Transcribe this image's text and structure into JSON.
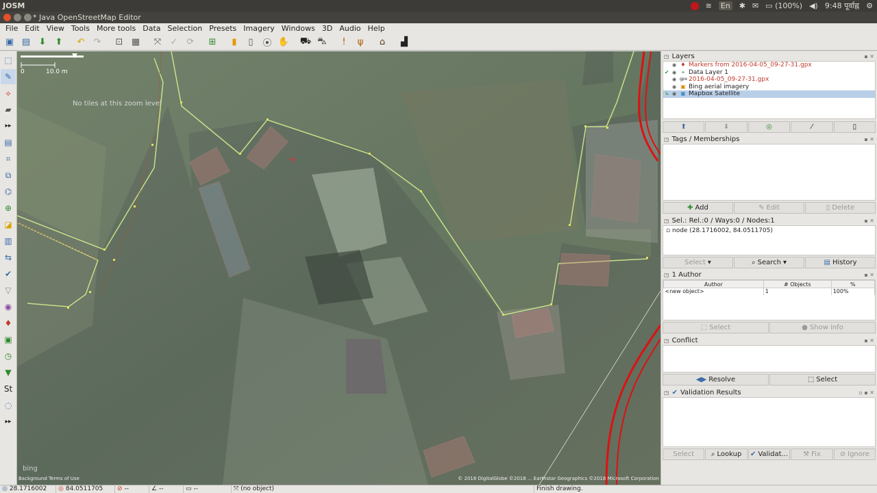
{
  "os": {
    "app_name": "JOSM",
    "language": "En",
    "battery": "(100%)",
    "clock": "9:48 पूर्वाह्न"
  },
  "window": {
    "title": "* Java OpenStreetMap Editor"
  },
  "menu": [
    "File",
    "Edit",
    "View",
    "Tools",
    "More tools",
    "Data",
    "Selection",
    "Presets",
    "Imagery",
    "Windows",
    "3D",
    "Audio",
    "Help"
  ],
  "map": {
    "scale_start": "0",
    "scale_end": "10.0 m",
    "no_tiles_text": "No tiles at this zoom level",
    "attribution_left": "Background Terms of Use",
    "attribution_right": "© 2018 DigitalGlobe ©2018 ... Earthstar Geographics ©2018 Microsoft Corporation",
    "bing_logo": "bing"
  },
  "layers": {
    "title": "Layers",
    "items": [
      {
        "name": "Markers from 2016-04-05_09-27-31.gpx",
        "color": "#c0392b",
        "selected": false
      },
      {
        "name": "Data Layer 1",
        "color": "#222222",
        "selected": false
      },
      {
        "name": "2016-04-05_09-27-31.gpx",
        "color": "#c0392b",
        "selected": false
      },
      {
        "name": "Bing aerial imagery",
        "color": "#222222",
        "selected": false
      },
      {
        "name": "Mapbox Satellite",
        "color": "#222222",
        "selected": true
      }
    ]
  },
  "tags": {
    "title": "Tags / Memberships",
    "add": "Add",
    "edit": "Edit",
    "delete": "Delete"
  },
  "selection": {
    "title": "Sel.: Rel.:0 / Ways:0 / Nodes:1",
    "item": "node (28.1716002, 84.0511705)",
    "select": "Select",
    "search": "Search",
    "history": "History"
  },
  "authors": {
    "title": "1 Author",
    "col_author": "Author",
    "col_objects": "# Objects",
    "col_pct": "%",
    "row_author": "<new object>",
    "row_objects": "1",
    "row_pct": "100%",
    "select": "Select",
    "show_info": "Show info"
  },
  "conflict": {
    "title": "Conflict",
    "resolve": "Resolve",
    "select": "Select"
  },
  "validation": {
    "title": "Validation Results",
    "select": "Select",
    "lookup": "Lookup",
    "validate": "Validat...",
    "fix": "Fix",
    "ignore": "Ignore"
  },
  "status": {
    "lat": "28.1716002",
    "lon": "84.0511705",
    "angle": "--",
    "length": "--",
    "distance": "--",
    "object": "(no object)",
    "help": "Finish drawing."
  }
}
